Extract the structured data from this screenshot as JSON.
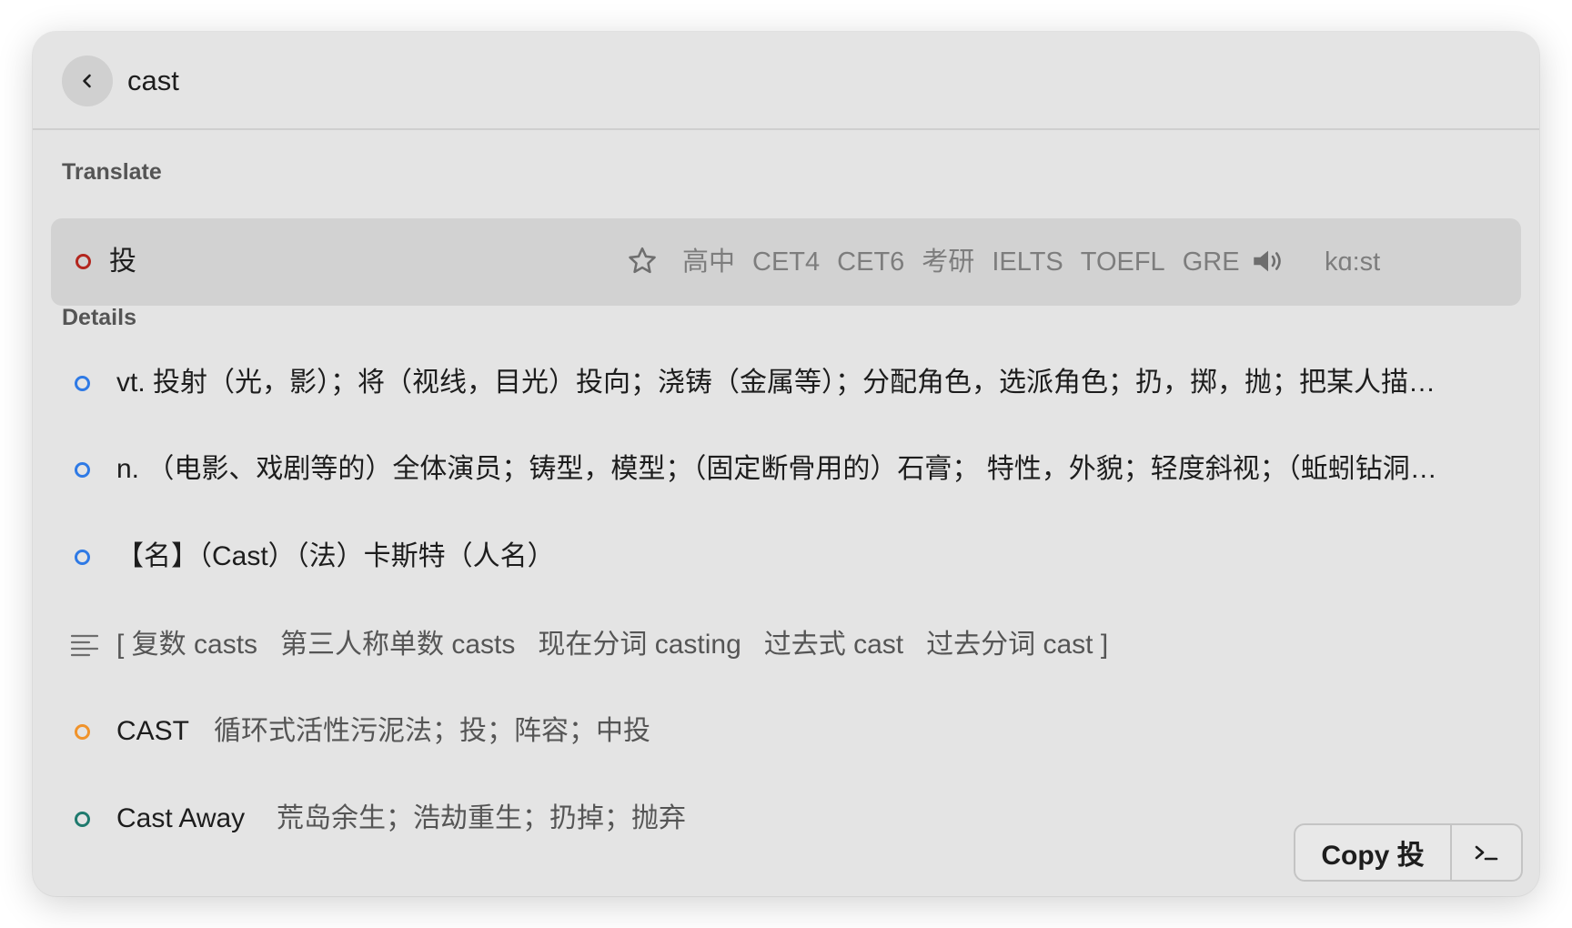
{
  "search": {
    "query": "cast"
  },
  "sections": {
    "translate_title": "Translate",
    "details_title": "Details"
  },
  "translate": {
    "word": "投",
    "tags": [
      "高中",
      "CET4",
      "CET6",
      "考研",
      "IELTS",
      "TOEFL",
      "GRE"
    ],
    "phonetic": "kɑ:st",
    "dot_color": "#b3261e"
  },
  "details": {
    "definitions": [
      {
        "text": "vt. 投射（光，影）；将（视线，目光）投向；浇铸（金属等）；分配角色，选派角色；扔，掷，抛；把某人描…",
        "dot_color": "#2f7ae5"
      },
      {
        "text": "n. （电影、戏剧等的）全体演员；铸型，模型；（固定断骨用的）石膏； 特性，外貌；轻度斜视；（蚯蚓钻洞…",
        "dot_color": "#2f7ae5"
      },
      {
        "text": "【名】（Cast）（法）卡斯特（人名）",
        "dot_color": "#2f7ae5"
      }
    ],
    "forms": "[ 复数 casts   第三人称单数 casts   现在分词 casting   过去式 cast   过去分词 cast ]",
    "phrases": [
      {
        "term": "CAST",
        "meaning": "循环式活性污泥法；投；阵容；中投",
        "dot_color": "#f0932b"
      },
      {
        "term": "Cast Away",
        "meaning": "荒岛余生；浩劫重生；扔掉；抛弃",
        "dot_color": "#1f7a6e"
      }
    ]
  },
  "actions": {
    "copy_label": "Copy 投",
    "terminal_icon": "terminal-icon"
  }
}
